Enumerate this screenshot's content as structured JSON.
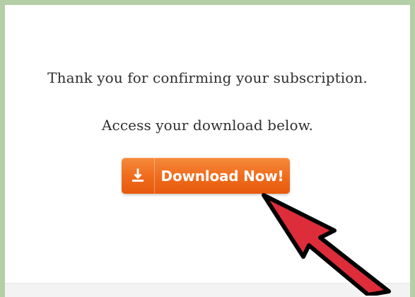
{
  "page": {
    "message_1": "Thank you for confirming your subscription.",
    "message_2": "Access your download below."
  },
  "download_button": {
    "label": "Download Now!",
    "icon": "download-icon",
    "color": "#f06d1e"
  },
  "pointer": {
    "icon": "red-arrow-icon",
    "color": "#de2d3a"
  }
}
